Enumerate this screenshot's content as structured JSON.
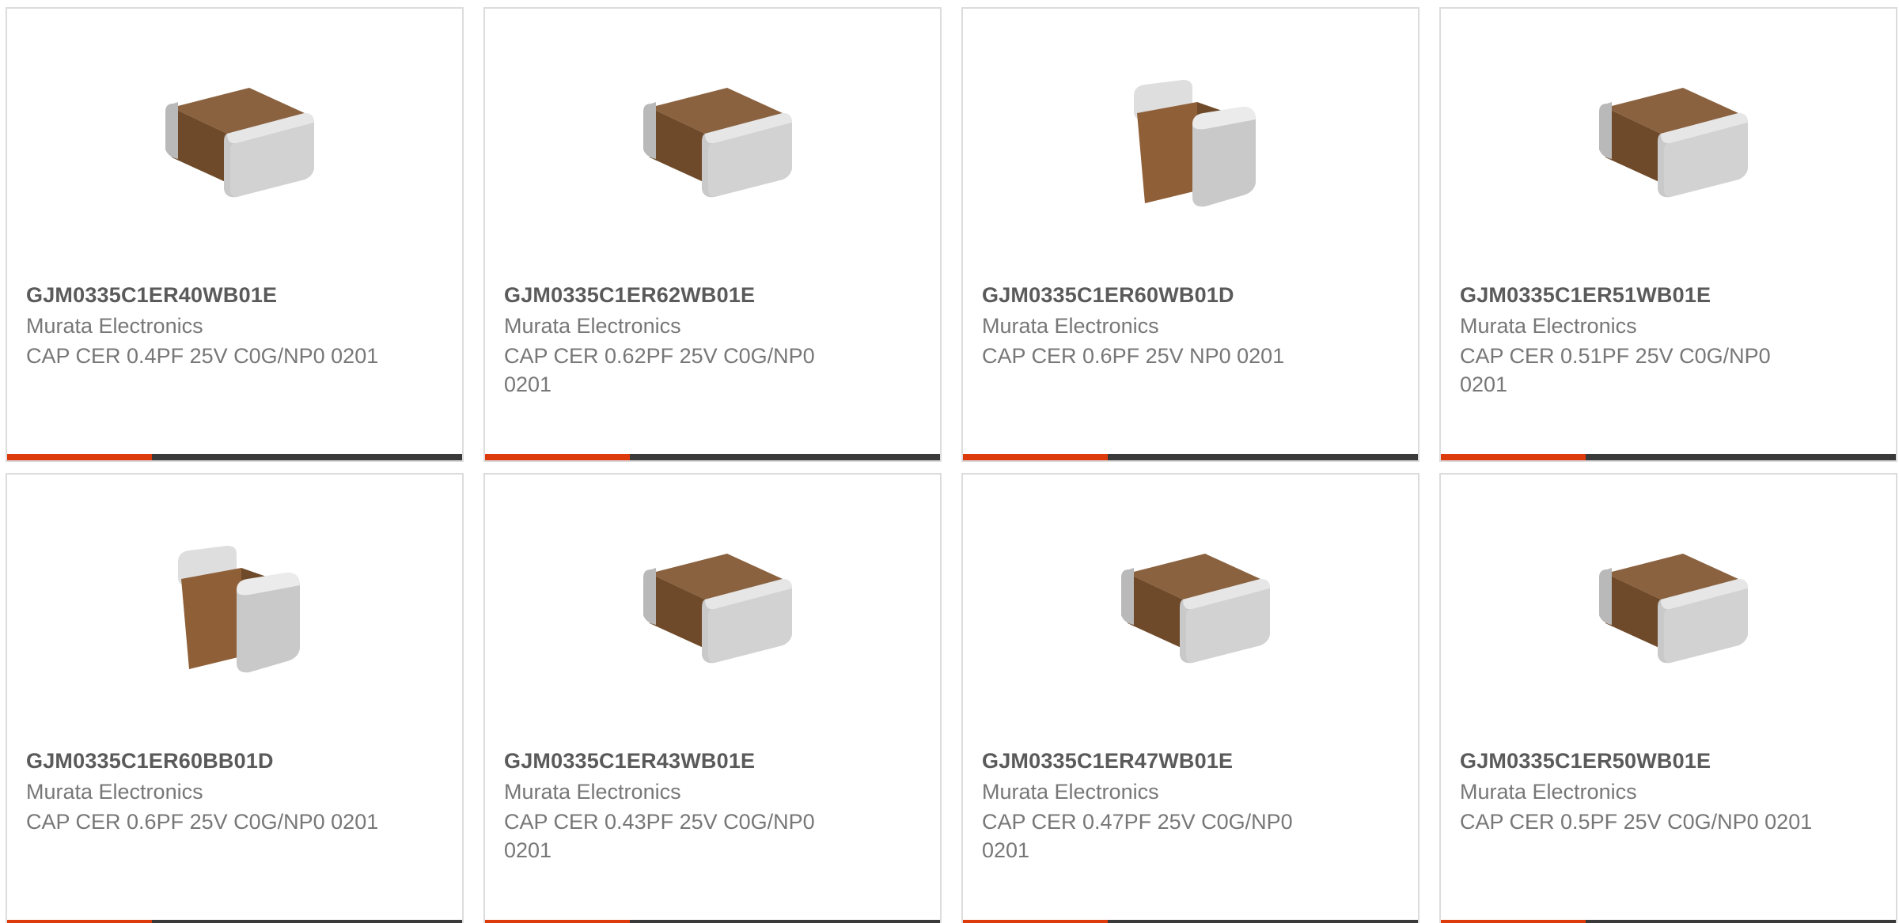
{
  "colors": {
    "accent": "#dd3b0c",
    "bar": "#3a3a3a",
    "part_text": "#5a5a5a",
    "body_text": "#777777",
    "border": "#dcdcdc",
    "body_ceramic": "#6e4a2a",
    "terminal_silver": "#c9c9c9"
  },
  "products": [
    {
      "part_number": "GJM0335C1ER40WB01E",
      "manufacturer": "Murata Electronics",
      "description": "CAP CER 0.4PF 25V C0G/NP0 0201",
      "image": "chip-capacitor-horizontal"
    },
    {
      "part_number": "GJM0335C1ER62WB01E",
      "manufacturer": "Murata Electronics",
      "description": "CAP CER 0.62PF 25V C0G/NP0 0201",
      "image": "chip-capacitor-horizontal"
    },
    {
      "part_number": "GJM0335C1ER60WB01D",
      "manufacturer": "Murata Electronics",
      "description": "CAP CER 0.6PF 25V NP0 0201",
      "image": "chip-capacitor-upright"
    },
    {
      "part_number": "GJM0335C1ER51WB01E",
      "manufacturer": "Murata Electronics",
      "description": "CAP CER 0.51PF 25V C0G/NP0 0201",
      "image": "chip-capacitor-horizontal"
    },
    {
      "part_number": "GJM0335C1ER60BB01D",
      "manufacturer": "Murata Electronics",
      "description": "CAP CER 0.6PF 25V C0G/NP0 0201",
      "image": "chip-capacitor-upright"
    },
    {
      "part_number": "GJM0335C1ER43WB01E",
      "manufacturer": "Murata Electronics",
      "description": "CAP CER 0.43PF 25V C0G/NP0 0201",
      "image": "chip-capacitor-horizontal"
    },
    {
      "part_number": "GJM0335C1ER47WB01E",
      "manufacturer": "Murata Electronics",
      "description": "CAP CER 0.47PF 25V C0G/NP0 0201",
      "image": "chip-capacitor-horizontal"
    },
    {
      "part_number": "GJM0335C1ER50WB01E",
      "manufacturer": "Murata Electronics",
      "description": "CAP CER 0.5PF 25V C0G/NP0 0201",
      "image": "chip-capacitor-horizontal"
    }
  ]
}
